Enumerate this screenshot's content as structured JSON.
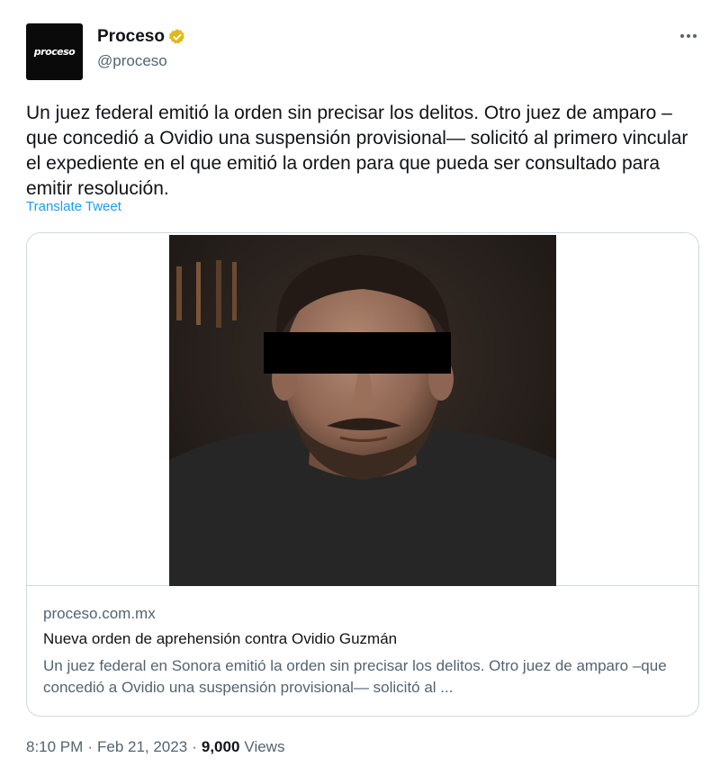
{
  "account": {
    "avatar_text": "proceso",
    "display_name": "Proceso",
    "handle": "@proceso",
    "verified_icon": "verified-badge-icon",
    "verified_color": "#e2b719"
  },
  "more_icon": "more-options-icon",
  "tweet": {
    "text": "Un juez federal emitió la orden sin precisar los delitos. Otro juez de amparo –que concedió a Ovidio una suspensión provisional— solicitó al primero vincular el expediente en el que emitió la orden para que pueda ser consultado para emitir resolución.",
    "translate_label": "Translate Tweet"
  },
  "card": {
    "domain": "proceso.com.mx",
    "title": "Nueva orden de aprehensión contra Ovidio Guzmán",
    "description": "Un juez federal en Sonora emitió la orden sin precisar los delitos. Otro juez de amparo –que concedió a Ovidio una suspensión provisional— solicitó al ..."
  },
  "meta": {
    "time": "8:10 PM",
    "date": "Feb 21, 2023",
    "views_count": "9,000",
    "views_label": "Views"
  },
  "colors": {
    "link": "#1d9bf0",
    "text": "#0f1419",
    "secondary": "#536471",
    "border": "#cfd9de"
  }
}
